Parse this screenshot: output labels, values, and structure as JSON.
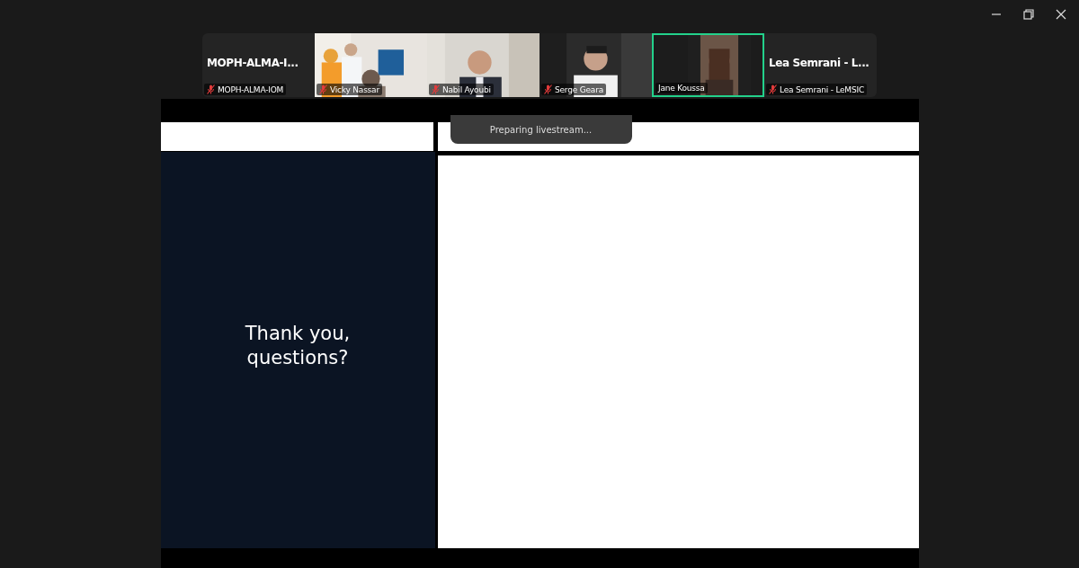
{
  "participants": [
    {
      "kind": "name",
      "title": "MOPH-ALMA-I...",
      "name": "MOPH-ALMA-IOM",
      "muted": true,
      "speaking": false
    },
    {
      "kind": "video",
      "name": "Vicky Nassar",
      "muted": true,
      "speaking": false
    },
    {
      "kind": "video",
      "name": "Nabil Ayoubi",
      "muted": true,
      "speaking": false
    },
    {
      "kind": "video",
      "name": "Serge Geara",
      "muted": true,
      "speaking": false
    },
    {
      "kind": "video",
      "name": "Jane Koussa",
      "muted": false,
      "speaking": true
    },
    {
      "kind": "name",
      "title": "Lea Semrani - L...",
      "name": "Lea Semrani - LeMSIC",
      "muted": true,
      "speaking": false
    }
  ],
  "shared_screen": {
    "slide_text": "Thank you,\nquestions?",
    "toast": "Preparing livestream..."
  }
}
